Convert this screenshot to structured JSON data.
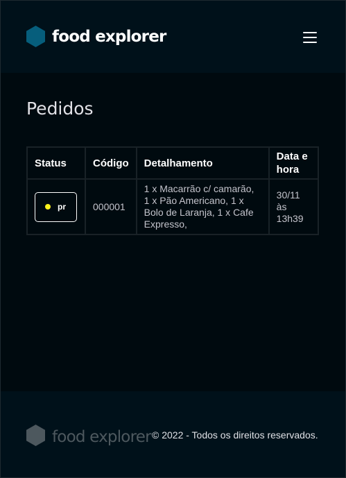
{
  "header": {
    "brand_name": "food explorer",
    "brand_icon": "hexagon-logo-icon",
    "menu_icon": "hamburger-menu-icon",
    "colors": {
      "logo": "#065e7c",
      "background": "#00111a"
    }
  },
  "main": {
    "title": "Pedidos",
    "table": {
      "columns": [
        "Status",
        "Código",
        "Detalhamento",
        "Data e hora"
      ],
      "rows": [
        {
          "status": {
            "label": "pr",
            "dot_color": "#fbf31d"
          },
          "code": "000001",
          "detail": "1 x Macarrão c/ camarão, 1 x Pão Americano, 1 x Bolo de Laranja, 1 x Cafe Expresso,",
          "date": "30/11 às 13h39"
        }
      ]
    }
  },
  "footer": {
    "brand_name": "food explorer",
    "copyright": "© 2022 - Todos os direitos reservados.",
    "colors": {
      "logo": "#4d585e"
    }
  }
}
